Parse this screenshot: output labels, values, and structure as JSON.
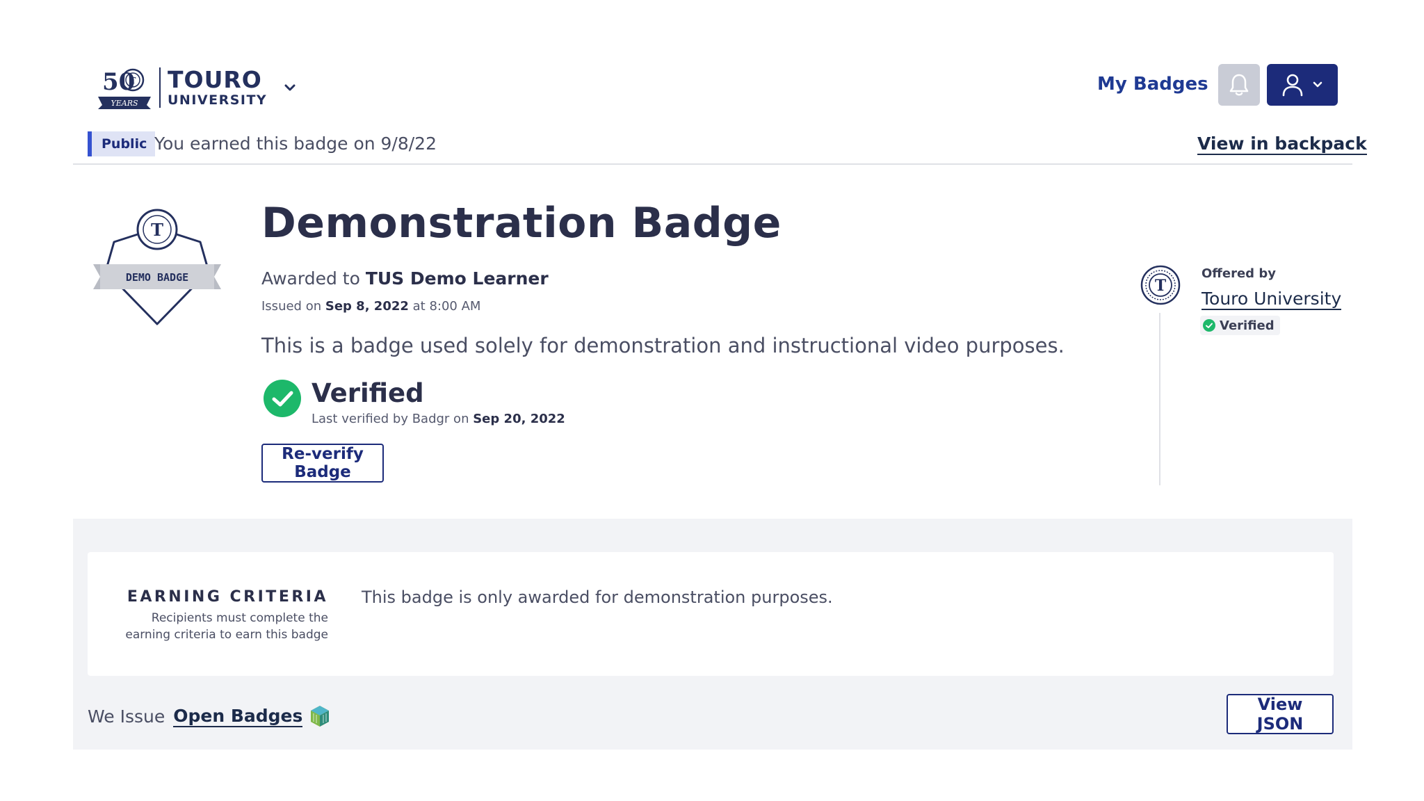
{
  "header": {
    "logo_years": "50",
    "logo_years_word": "YEARS",
    "logo_name": "TOURO",
    "logo_sub": "UNIVERSITY",
    "nav_my_badges": "My Badges"
  },
  "status_bar": {
    "visibility": "Public",
    "earned_text": "You earned this badge on 9/8/22",
    "view_backpack": "View in backpack"
  },
  "badge": {
    "image_label": "DEMO BADGE",
    "title": "Demonstration Badge",
    "awarded_prefix": "Awarded to",
    "recipient": "TUS Demo Learner",
    "issued_prefix": "Issued on",
    "issued_date": "Sep 8, 2022",
    "issued_time": "at 8:00 AM",
    "description": "This is a badge used solely for demonstration and instructional video purposes.",
    "verified_label": "Verified",
    "verified_sub_prefix": "Last verified by Badgr on",
    "verified_date": "Sep 20, 2022",
    "reverify_label": "Re-verify Badge"
  },
  "issuer": {
    "offered_by": "Offered by",
    "name": "Touro University",
    "verified_label": "Verified"
  },
  "criteria": {
    "heading": "EARNING CRITERIA",
    "help": "Recipients must complete the earning criteria to earn this badge",
    "text": "This badge is only awarded for demonstration purposes."
  },
  "footer": {
    "we_issue": "We Issue",
    "open_badges": "Open Badges",
    "view_json": "View JSON"
  },
  "colors": {
    "primary": "#1c2b7a",
    "text": "#2b2f4a",
    "verified_green": "#1db86a",
    "public_accent": "#3552d0",
    "section_bg": "#f2f3f6"
  },
  "icons": [
    "touro-logo-emblem",
    "chevron-down-icon",
    "bell-icon",
    "user-icon",
    "check-circle-icon",
    "open-badges-icon"
  ]
}
